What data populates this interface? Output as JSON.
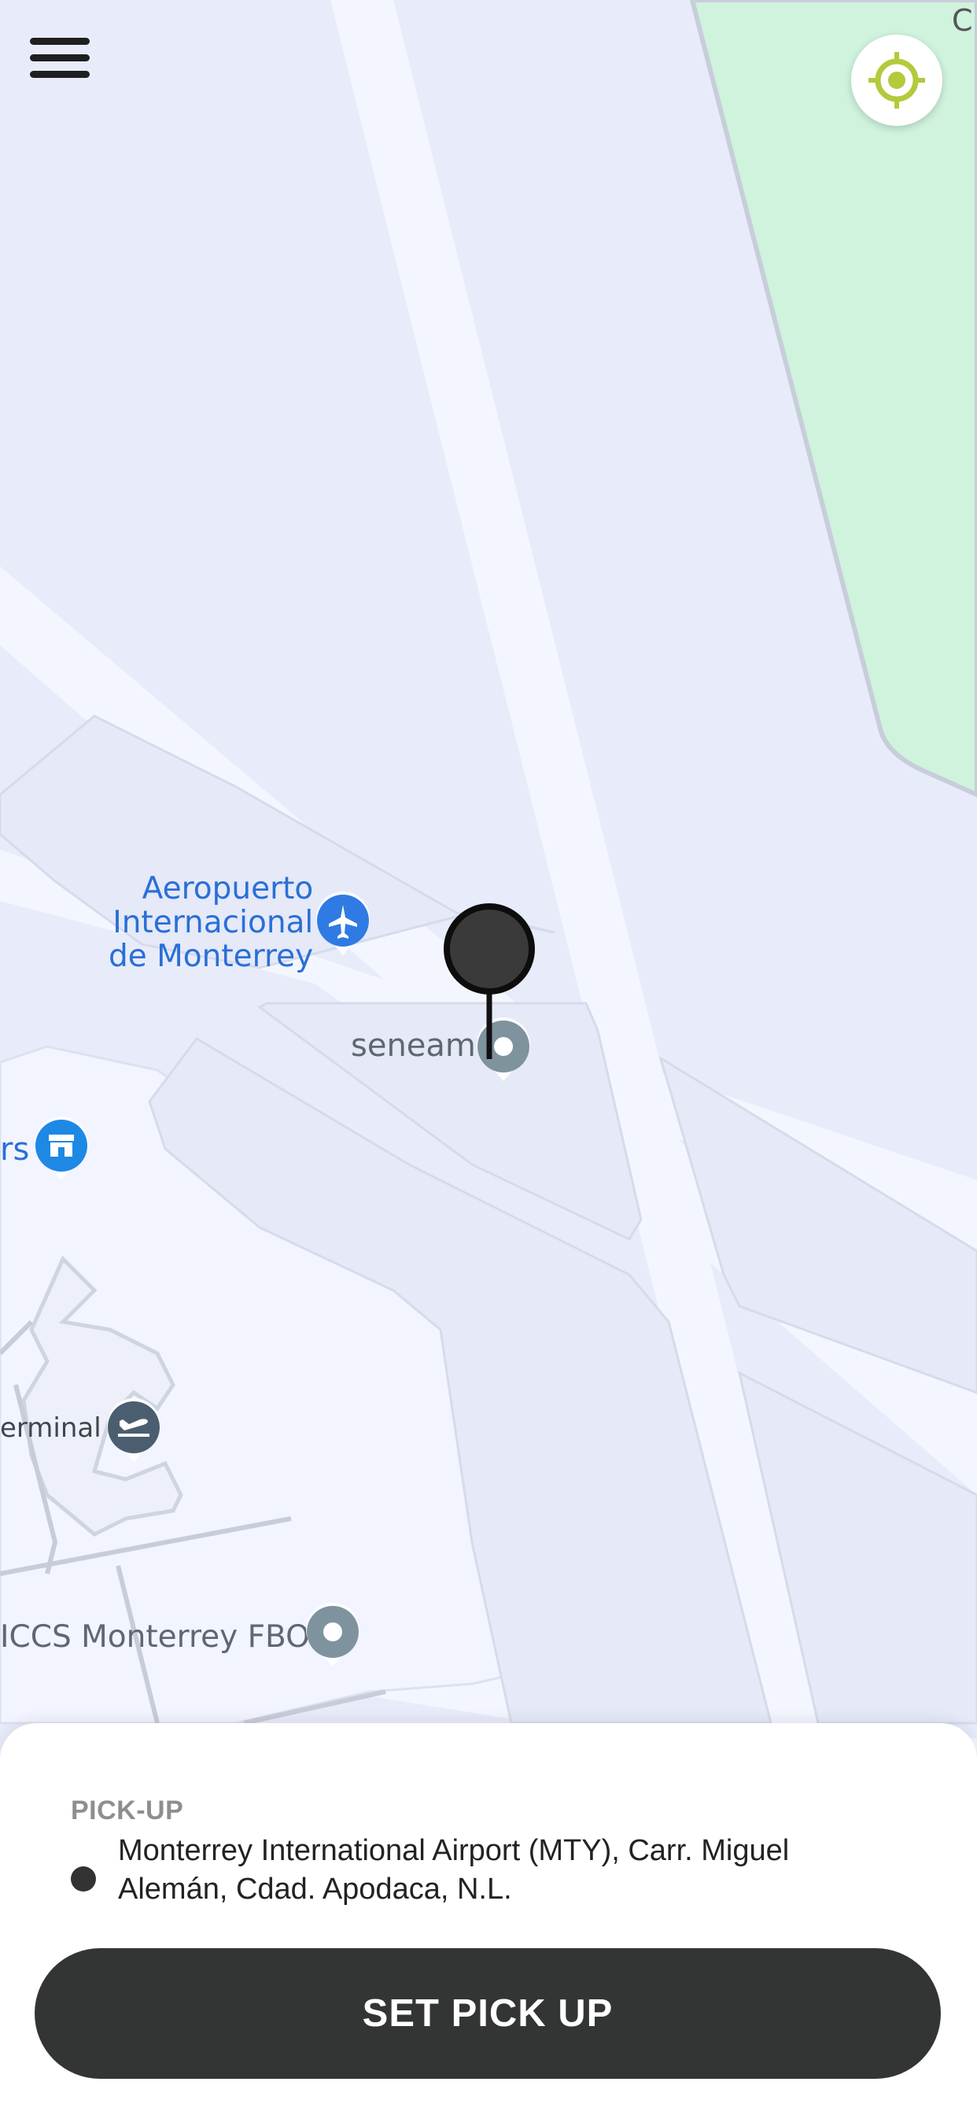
{
  "map": {
    "poi_airport": [
      "Aeropuerto",
      "Internacional",
      "de Monterrey"
    ],
    "poi_seneam": "seneam",
    "poi_store_partial": "rs",
    "poi_terminal_partial": "erminal B",
    "poi_fbo_partial": "ICCS Monterrey FBO",
    "corner_partial": "C",
    "icons": {
      "airport": "airplane-icon",
      "store": "store-icon",
      "terminal": "departures-icon",
      "generic": "place-dot-icon"
    }
  },
  "controls": {
    "menu_icon": "hamburger-menu-icon",
    "locate_icon": "crosshair-icon",
    "locate_color": "#b5c93b"
  },
  "sheet": {
    "pickup_label": "PICK-UP",
    "pickup_address": "Monterrey International Airport (MTY), Carr. Miguel Alemán, Cdad. Apodaca, N.L.",
    "button_label": "SET PICK UP"
  },
  "colors": {
    "map_base": "#e8ecfa",
    "road": "#f4f6ff",
    "park": "#cff3dd",
    "button": "#333535"
  }
}
